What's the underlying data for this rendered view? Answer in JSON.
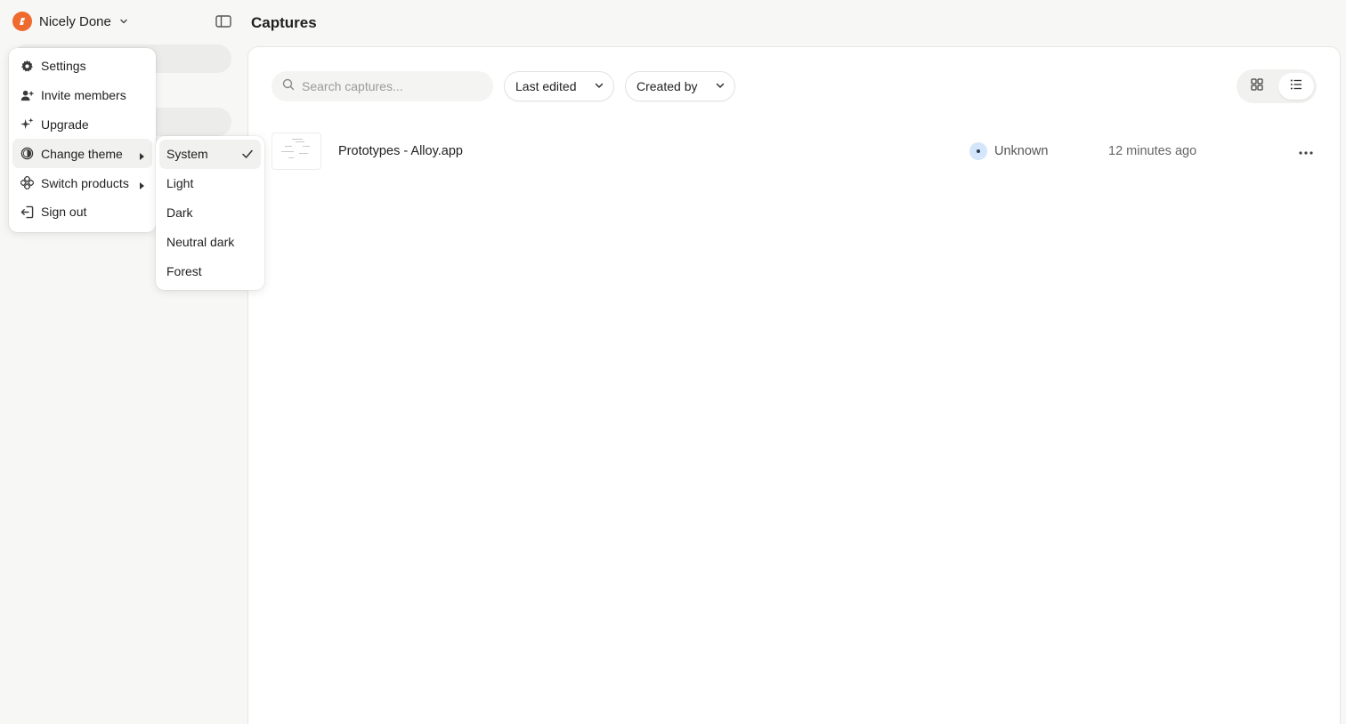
{
  "workspace": {
    "name": "Nicely Done"
  },
  "header": {
    "title": "Captures"
  },
  "toolbar": {
    "search_placeholder": "Search captures...",
    "sort_label": "Last edited",
    "creator_filter_label": "Created by",
    "view_mode": "list"
  },
  "captures": [
    {
      "title": "Prototypes - Alloy.app",
      "owner": "Unknown",
      "edited": "12 minutes ago"
    }
  ],
  "account_menu": {
    "items": [
      {
        "label": "Settings",
        "icon": "gear-icon"
      },
      {
        "label": "Invite members",
        "icon": "user-plus-icon"
      },
      {
        "label": "Upgrade",
        "icon": "sparkle-icon"
      },
      {
        "label": "Change theme",
        "icon": "theme-icon",
        "submenu": true
      },
      {
        "label": "Switch products",
        "icon": "products-icon",
        "submenu": true
      },
      {
        "label": "Sign out",
        "icon": "sign-out-icon"
      }
    ]
  },
  "theme_menu": {
    "selected": "System",
    "options": [
      "System",
      "Light",
      "Dark",
      "Neutral dark",
      "Forest"
    ]
  },
  "colors": {
    "brand": "#ee6a2e",
    "background": "#f7f7f6",
    "panel": "#ffffff",
    "avatar": "#d4e6fb"
  }
}
